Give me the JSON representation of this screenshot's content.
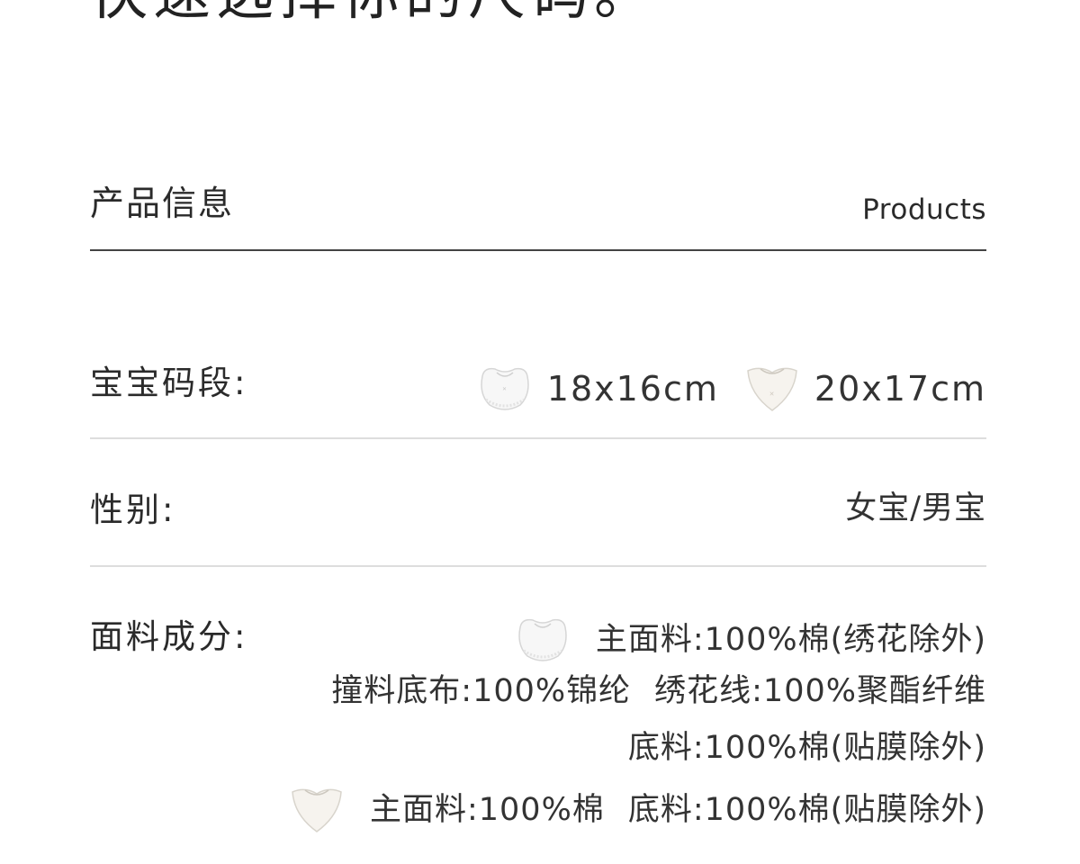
{
  "top_heading": "快速选择你的尺码。",
  "section": {
    "title": "产品信息",
    "subtitle": "Products"
  },
  "rows": {
    "size": {
      "label": "宝宝码段:",
      "option_1": "18x16cm",
      "option_2": "20x17cm",
      "icon_1": "round-bib-icon",
      "icon_2": "triangle-bib-icon"
    },
    "gender": {
      "label": "性别:",
      "value": "女宝/男宝"
    },
    "material": {
      "label": "面料成分:",
      "line_1": "主面料:100%棉(绣花除外)",
      "line_2a": "撞料底布:100%锦纶",
      "line_2b": "绣花线:100%聚酯纤维",
      "line_3": "底料:100%棉(贴膜除外)",
      "line_4a": "主面料:100%棉",
      "line_4b": "底料:100%棉(贴膜除外)",
      "icon_1": "round-bib-icon",
      "icon_2": "triangle-bib-icon"
    }
  }
}
